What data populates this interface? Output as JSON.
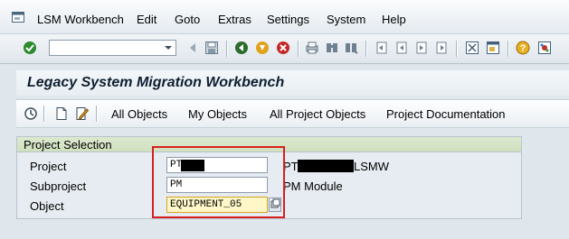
{
  "menu": {
    "items": [
      "LSM Workbench",
      "Edit",
      "Goto",
      "Extras",
      "Settings",
      "System",
      "Help"
    ]
  },
  "toolbar": {
    "command_field_value": "",
    "icons": [
      "enter-icon",
      "save-icon",
      "back-icon",
      "exit-icon",
      "cancel-icon",
      "print-icon",
      "find-icon",
      "find-next-icon",
      "first-page-icon",
      "previous-page-icon",
      "next-page-icon",
      "last-page-icon",
      "new-session-icon",
      "shortcut-icon",
      "help-icon",
      "customize-layout-icon"
    ]
  },
  "title": "Legacy System Migration Workbench",
  "app_toolbar": {
    "buttons": [
      "All Objects",
      "My Objects",
      "All Project Objects",
      "Project Documentation"
    ]
  },
  "group": {
    "title": "Project Selection",
    "rows": [
      {
        "label": "Project",
        "value": "PT",
        "description_prefix": "PT",
        "description_suffix": "LSMW"
      },
      {
        "label": "Subproject",
        "value": "PM",
        "description": "PM Module"
      },
      {
        "label": "Object",
        "value": "EQUIPMENT_05"
      }
    ]
  },
  "colors": {
    "highlight_border": "#d62020",
    "active_field": "#fff7c8"
  }
}
